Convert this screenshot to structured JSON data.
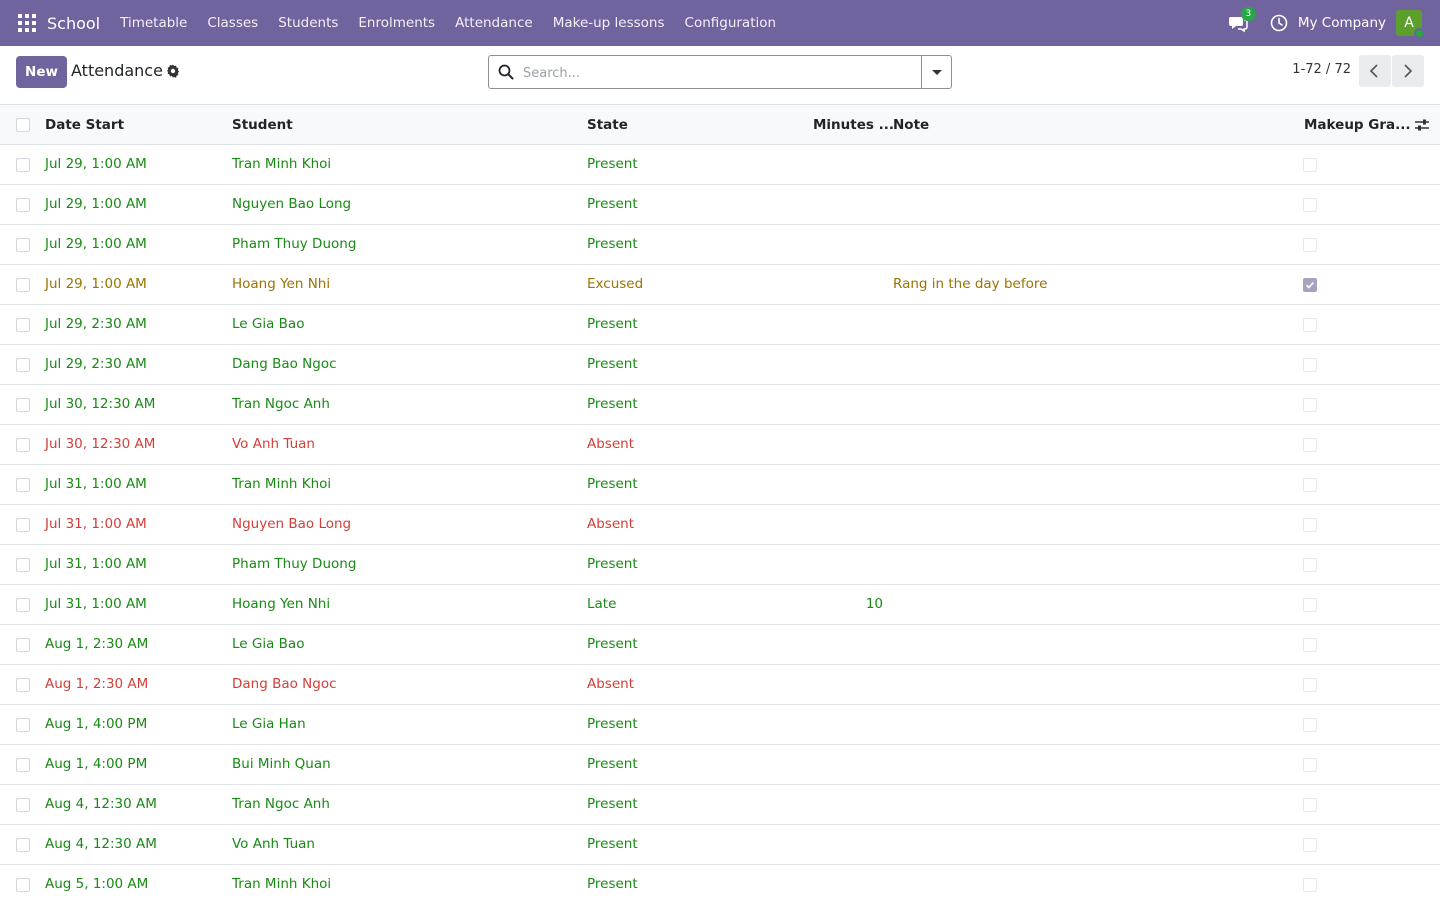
{
  "navbar": {
    "app_name": "School",
    "menu": [
      "Timetable",
      "Classes",
      "Students",
      "Enrolments",
      "Attendance",
      "Make-up lessons",
      "Configuration"
    ],
    "messages_count": "3",
    "company": "My Company",
    "avatar_letter": "A",
    "bg_color": "#71639e"
  },
  "control_panel": {
    "new_label": "New",
    "title": "Attendance",
    "search_placeholder": "Search...",
    "pager": "1-72 / 72"
  },
  "table": {
    "columns": [
      "Date Start",
      "Student",
      "State",
      "Minutes ...",
      "Note",
      "Makeup Gra..."
    ],
    "colors": {
      "present": "#198a15",
      "excused": "#997404",
      "absent": "#d23f3a"
    },
    "rows": [
      {
        "date": "Jul 29, 1:00 AM",
        "student": "Tran Minh Khoi",
        "state": "Present",
        "minutes": "",
        "note": "",
        "makeup": false,
        "tone": "present"
      },
      {
        "date": "Jul 29, 1:00 AM",
        "student": "Nguyen Bao Long",
        "state": "Present",
        "minutes": "",
        "note": "",
        "makeup": false,
        "tone": "present"
      },
      {
        "date": "Jul 29, 1:00 AM",
        "student": "Pham Thuy Duong",
        "state": "Present",
        "minutes": "",
        "note": "",
        "makeup": false,
        "tone": "present"
      },
      {
        "date": "Jul 29, 1:00 AM",
        "student": "Hoang Yen Nhi",
        "state": "Excused",
        "minutes": "",
        "note": "Rang in the day before",
        "makeup": true,
        "tone": "excused"
      },
      {
        "date": "Jul 29, 2:30 AM",
        "student": "Le Gia Bao",
        "state": "Present",
        "minutes": "",
        "note": "",
        "makeup": false,
        "tone": "present"
      },
      {
        "date": "Jul 29, 2:30 AM",
        "student": "Dang Bao Ngoc",
        "state": "Present",
        "minutes": "",
        "note": "",
        "makeup": false,
        "tone": "present"
      },
      {
        "date": "Jul 30, 12:30 AM",
        "student": "Tran Ngoc Anh",
        "state": "Present",
        "minutes": "",
        "note": "",
        "makeup": false,
        "tone": "present"
      },
      {
        "date": "Jul 30, 12:30 AM",
        "student": "Vo Anh Tuan",
        "state": "Absent",
        "minutes": "",
        "note": "",
        "makeup": false,
        "tone": "absent"
      },
      {
        "date": "Jul 31, 1:00 AM",
        "student": "Tran Minh Khoi",
        "state": "Present",
        "minutes": "",
        "note": "",
        "makeup": false,
        "tone": "present"
      },
      {
        "date": "Jul 31, 1:00 AM",
        "student": "Nguyen Bao Long",
        "state": "Absent",
        "minutes": "",
        "note": "",
        "makeup": false,
        "tone": "absent"
      },
      {
        "date": "Jul 31, 1:00 AM",
        "student": "Pham Thuy Duong",
        "state": "Present",
        "minutes": "",
        "note": "",
        "makeup": false,
        "tone": "present"
      },
      {
        "date": "Jul 31, 1:00 AM",
        "student": "Hoang Yen Nhi",
        "state": "Late",
        "minutes": "10",
        "note": "",
        "makeup": false,
        "tone": "present"
      },
      {
        "date": "Aug 1, 2:30 AM",
        "student": "Le Gia Bao",
        "state": "Present",
        "minutes": "",
        "note": "",
        "makeup": false,
        "tone": "present"
      },
      {
        "date": "Aug 1, 2:30 AM",
        "student": "Dang Bao Ngoc",
        "state": "Absent",
        "minutes": "",
        "note": "",
        "makeup": false,
        "tone": "absent"
      },
      {
        "date": "Aug 1, 4:00 PM",
        "student": "Le Gia Han",
        "state": "Present",
        "minutes": "",
        "note": "",
        "makeup": false,
        "tone": "present"
      },
      {
        "date": "Aug 1, 4:00 PM",
        "student": "Bui Minh Quan",
        "state": "Present",
        "minutes": "",
        "note": "",
        "makeup": false,
        "tone": "present"
      },
      {
        "date": "Aug 4, 12:30 AM",
        "student": "Tran Ngoc Anh",
        "state": "Present",
        "minutes": "",
        "note": "",
        "makeup": false,
        "tone": "present"
      },
      {
        "date": "Aug 4, 12:30 AM",
        "student": "Vo Anh Tuan",
        "state": "Present",
        "minutes": "",
        "note": "",
        "makeup": false,
        "tone": "present"
      },
      {
        "date": "Aug 5, 1:00 AM",
        "student": "Tran Minh Khoi",
        "state": "Present",
        "minutes": "",
        "note": "",
        "makeup": false,
        "tone": "present"
      }
    ]
  }
}
